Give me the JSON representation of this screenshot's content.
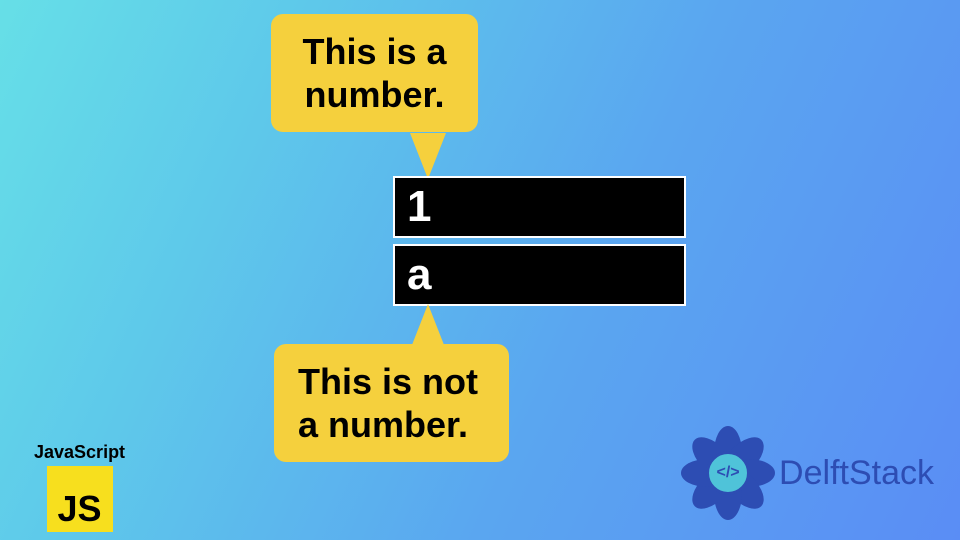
{
  "bubble_top": "This is a number.",
  "bubble_bottom": "This is not a number.",
  "box1": "1",
  "box2": "a",
  "js_label": "JavaScript",
  "js_square": "JS",
  "delft_text": "DelftStack",
  "delft_center": "</>"
}
